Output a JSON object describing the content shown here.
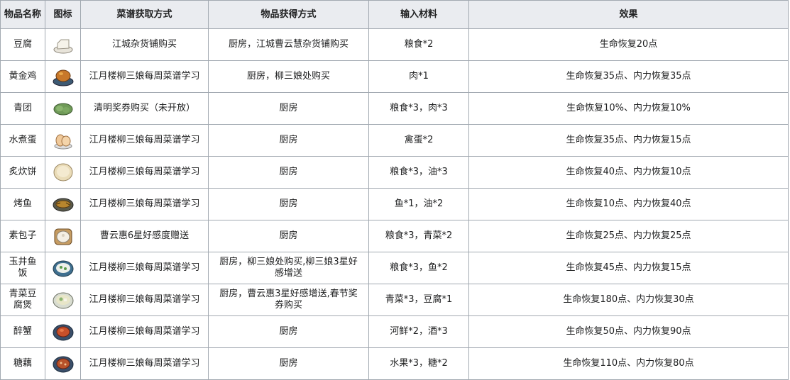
{
  "headers": [
    "物品名称",
    "图标",
    "菜谱获取方式",
    "物品获得方式",
    "输入材料",
    "效果"
  ],
  "rows": [
    {
      "name": "豆腐",
      "icon": "tofu-icon",
      "recipe": "江城杂货铺购买",
      "obtain": "厨房，江城曹云慧杂货铺购买",
      "materials": "粮食*2",
      "effect": "生命恢复20点"
    },
    {
      "name": "黄金鸡",
      "icon": "golden-chicken-icon",
      "recipe": "江月楼柳三娘每周菜谱学习",
      "obtain": "厨房，柳三娘处购买",
      "materials": "肉*1",
      "effect": "生命恢复35点、内力恢复35点"
    },
    {
      "name": "青团",
      "icon": "green-dumpling-icon",
      "recipe": "清明奖券购买（未开放）",
      "obtain": "厨房",
      "materials": "粮食*3，肉*3",
      "effect": "生命恢复10%、内力恢复10%"
    },
    {
      "name": "水煮蛋",
      "icon": "boiled-egg-icon",
      "recipe": "江月楼柳三娘每周菜谱学习",
      "obtain": "厨房",
      "materials": "禽蛋*2",
      "effect": "生命恢复35点、内力恢复15点"
    },
    {
      "name": "炙炊饼",
      "icon": "flatbread-icon",
      "recipe": "江月楼柳三娘每周菜谱学习",
      "obtain": "厨房",
      "materials": "粮食*3，油*3",
      "effect": "生命恢复40点、内力恢复10点"
    },
    {
      "name": "烤鱼",
      "icon": "grilled-fish-icon",
      "recipe": "江月楼柳三娘每周菜谱学习",
      "obtain": "厨房",
      "materials": "鱼*1，油*2",
      "effect": "生命恢复10点、内力恢复40点"
    },
    {
      "name": "素包子",
      "icon": "steamed-bun-icon",
      "recipe": "曹云惠6星好感度赠送",
      "obtain": "厨房",
      "materials": "粮食*3，青菜*2",
      "effect": "生命恢复25点、内力恢复25点"
    },
    {
      "name": "玉井鱼饭",
      "icon": "fish-rice-icon",
      "recipe": "江月楼柳三娘每周菜谱学习",
      "obtain": "厨房，柳三娘处购买,柳三娘3星好感增送",
      "materials": "粮食*3，鱼*2",
      "effect": "生命恢复45点、内力恢复15点"
    },
    {
      "name": "青菜豆腐煲",
      "icon": "tofu-stew-icon",
      "recipe": "江月楼柳三娘每周菜谱学习",
      "obtain": "厨房，曹云惠3星好感增送,春节奖券购买",
      "materials": "青菜*3，豆腐*1",
      "effect": "生命恢复180点、内力恢复30点"
    },
    {
      "name": "醉蟹",
      "icon": "drunken-crab-icon",
      "recipe": "江月楼柳三娘每周菜谱学习",
      "obtain": "厨房",
      "materials": "河鲜*2，酒*3",
      "effect": "生命恢复50点、内力恢复90点"
    },
    {
      "name": "糖藕",
      "icon": "sugar-lotus-icon",
      "recipe": "江月楼柳三娘每周菜谱学习",
      "obtain": "厨房",
      "materials": "水果*3，糖*2",
      "effect": "生命恢复110点、内力恢复80点"
    }
  ]
}
